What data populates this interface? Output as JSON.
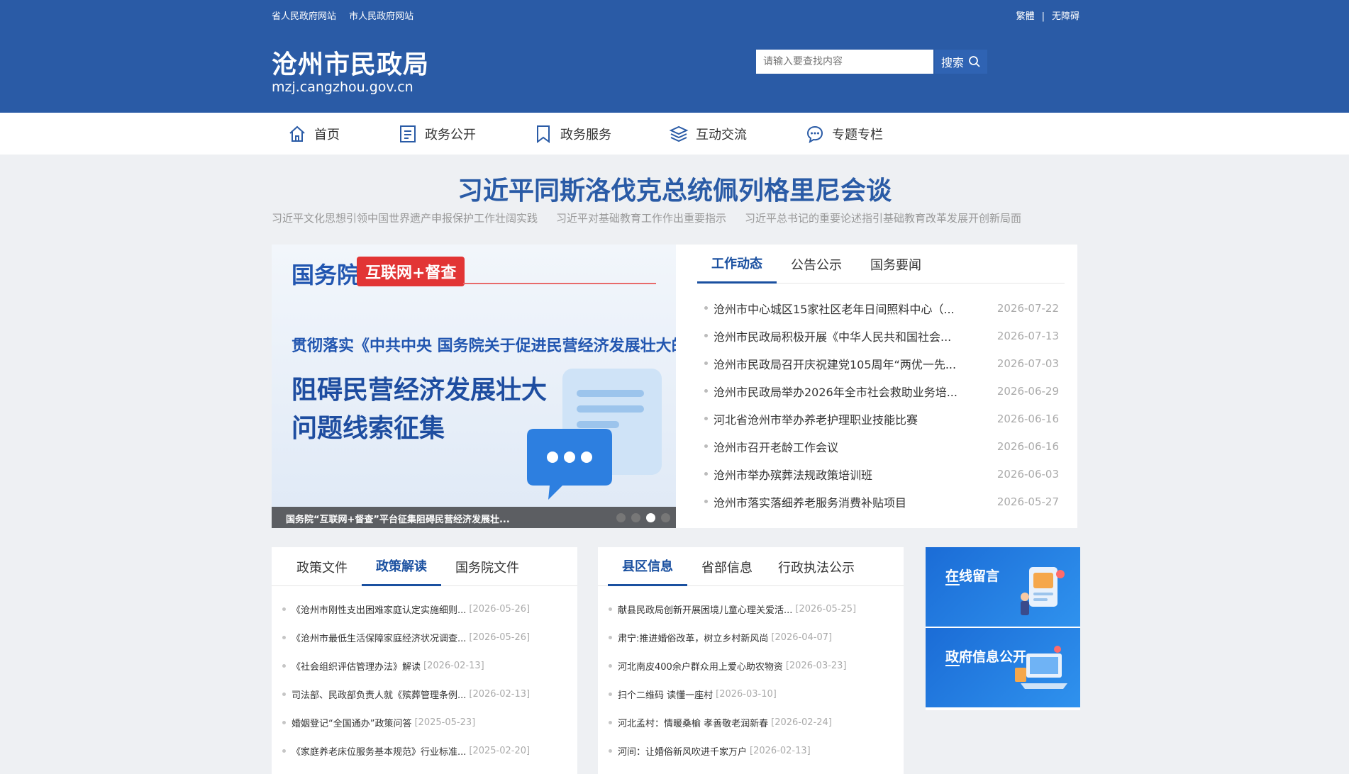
{
  "header": {
    "top_links": [
      "省人民政府网站",
      "市人民政府网站"
    ],
    "right_links": [
      "繁體",
      "无障碍"
    ],
    "right_sep": "|",
    "title": "沧州市民政局",
    "domain": "mzj.cangzhou.gov.cn",
    "search_placeholder": "请输入要查找内容",
    "search_label": "搜索"
  },
  "nav": {
    "items": [
      {
        "label": "首页",
        "icon": "home-icon"
      },
      {
        "label": "政务公开",
        "icon": "document-icon"
      },
      {
        "label": "政务服务",
        "icon": "bookmark-icon"
      },
      {
        "label": "互动交流",
        "icon": "layers-icon"
      },
      {
        "label": "专题专栏",
        "icon": "chat-bubble-icon"
      }
    ]
  },
  "headline": {
    "title": "习近平同斯洛伐克总统佩列格里尼会谈",
    "sub_links": [
      "习近平文化思想引领中国世界遗产申报保护工作壮阔实践",
      "习近平对基础教育工作作出重要指示",
      "习近平总书记的重要论述指引基础教育改革发展开创新局面"
    ]
  },
  "carousel": {
    "brand": "国务院",
    "tag": "互联网+督查",
    "subtitle": "贯彻落实《中共中央 国务院关于促进民营经济发展壮大的意见》",
    "big_line1": "阻碍民营经济发展壮大",
    "big_line2": "问题线索征集",
    "caption": "国务院“互联网+督查”平台征集阻碍民营经济发展壮...",
    "dots": 4,
    "active_dot": 2
  },
  "news": {
    "tabs": [
      "工作动态",
      "公告公示",
      "国务要闻"
    ],
    "active_tab": 0,
    "items": [
      {
        "title": "沧州市中心城区15家社区老年日间照料中心（...",
        "date": "2026-07-22"
      },
      {
        "title": "沧州市民政局积极开展《中华人民共和国社会...",
        "date": "2026-07-13"
      },
      {
        "title": "沧州市民政局召开庆祝建党105周年“两优一先...",
        "date": "2026-07-03"
      },
      {
        "title": "沧州市民政局举办2026年全市社会救助业务培...",
        "date": "2026-06-29"
      },
      {
        "title": "河北省沧州市举办养老护理职业技能比赛",
        "date": "2026-06-16"
      },
      {
        "title": "沧州市召开老龄工作会议",
        "date": "2026-06-16"
      },
      {
        "title": "沧州市举办殡葬法规政策培训班",
        "date": "2026-06-03"
      },
      {
        "title": "沧州市落实落细养老服务消费补贴项目",
        "date": "2026-05-27"
      }
    ]
  },
  "policy_panel": {
    "tabs": [
      "政策文件",
      "政策解读",
      "国务院文件"
    ],
    "active_tab": 1,
    "items": [
      {
        "title": "《沧州市刚性支出困难家庭认定实施细则...",
        "date": "[2026-05-26]"
      },
      {
        "title": "《沧州市最低生活保障家庭经济状况调查...",
        "date": "[2026-05-26]"
      },
      {
        "title": "《社会组织评估管理办法》解读",
        "date": "[2026-02-13]"
      },
      {
        "title": "司法部、民政部负责人就《殡葬管理条例...",
        "date": "[2026-02-13]"
      },
      {
        "title": "婚姻登记“全国通办”政策问答",
        "date": "[2025-05-23]"
      },
      {
        "title": "《家庭养老床位服务基本规范》行业标准...",
        "date": "[2025-02-20]"
      }
    ]
  },
  "county_panel": {
    "tabs": [
      "县区信息",
      "省部信息",
      "行政执法公示"
    ],
    "active_tab": 0,
    "items": [
      {
        "title": "献县民政局创新开展困境儿童心理关爱活...",
        "date": "[2026-05-25]"
      },
      {
        "title": "肃宁:推进婚俗改革，树立乡村新风尚",
        "date": "[2026-04-07]"
      },
      {
        "title": "河北南皮400余户群众用上爱心助农物资",
        "date": "[2026-03-23]"
      },
      {
        "title": "扫个二维码 读懂一座村",
        "date": "[2026-03-10]"
      },
      {
        "title": "河北孟村：情暖桑榆 孝善敬老润新春",
        "date": "[2026-02-24]"
      },
      {
        "title": "河间：让婚俗新风吹进千家万户",
        "date": "[2026-02-13]"
      }
    ]
  },
  "side_banners": [
    {
      "label": "在线留言",
      "icon": "message-illustration-icon"
    },
    {
      "label": "政府信息公开",
      "icon": "laptop-illustration-icon"
    }
  ],
  "colors": {
    "brand_blue": "#2a5ba6",
    "active_tab": "#1a50a0",
    "tag_red": "#e23535"
  }
}
